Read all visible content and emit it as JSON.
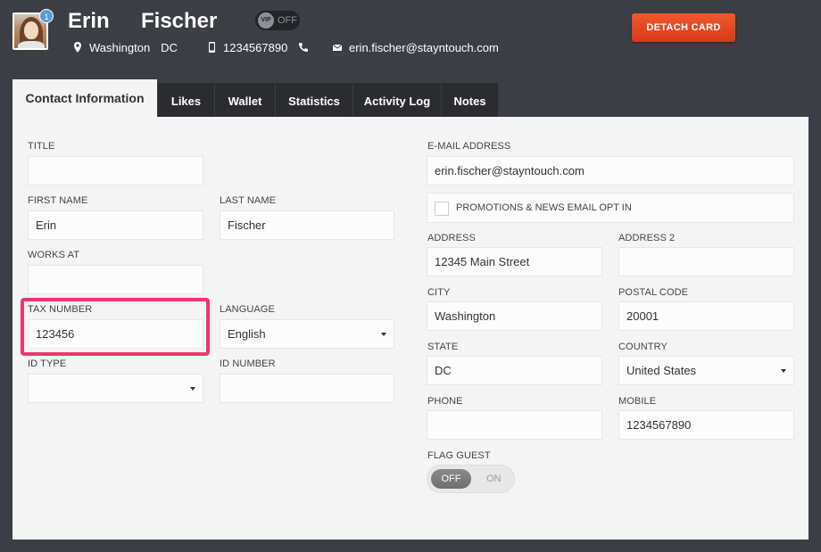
{
  "header": {
    "avatar_badge": "1",
    "first_name": "Erin",
    "last_name": "Fischer",
    "vip": {
      "knob_label": "VIP",
      "state_label": "OFF"
    },
    "city": "Washington",
    "state": "DC",
    "phone": "1234567890",
    "email": "erin.fischer@stayntouch.com",
    "detach_button_label": "DETACH CARD",
    "accent_color": "#e2401f"
  },
  "tabs": [
    {
      "label": "Contact Information",
      "active": true
    },
    {
      "label": "Likes"
    },
    {
      "label": "Wallet"
    },
    {
      "label": "Statistics"
    },
    {
      "label": "Activity Log"
    },
    {
      "label": "Notes"
    }
  ],
  "form": {
    "title": {
      "label": "TITLE",
      "value": ""
    },
    "first_name": {
      "label": "FIRST NAME",
      "value": "Erin"
    },
    "last_name": {
      "label": "LAST NAME",
      "value": "Fischer"
    },
    "works_at": {
      "label": "WORKS AT",
      "value": ""
    },
    "tax_number": {
      "label": "TAX NUMBER",
      "value": "123456"
    },
    "language": {
      "label": "LANGUAGE",
      "value": "English"
    },
    "id_type": {
      "label": "ID TYPE",
      "value": ""
    },
    "id_number": {
      "label": "ID NUMBER",
      "value": ""
    },
    "email": {
      "label": "E-MAIL ADDRESS",
      "value": "erin.fischer@stayntouch.com"
    },
    "promotions_label": "PROMOTIONS & NEWS EMAIL OPT IN",
    "address": {
      "label": "ADDRESS",
      "value": "12345 Main Street"
    },
    "address2": {
      "label": "ADDRESS 2",
      "value": ""
    },
    "city": {
      "label": "CITY",
      "value": "Washington"
    },
    "postal_code": {
      "label": "POSTAL CODE",
      "value": "20001"
    },
    "state": {
      "label": "STATE",
      "value": "DC"
    },
    "country": {
      "label": "COUNTRY",
      "value": "United States"
    },
    "phone": {
      "label": "PHONE",
      "value": ""
    },
    "mobile": {
      "label": "MOBILE",
      "value": "1234567890"
    },
    "flag_guest": {
      "label": "FLAG GUEST",
      "off_label": "OFF",
      "on_label": "ON"
    }
  },
  "highlight_color": "#f0356f"
}
